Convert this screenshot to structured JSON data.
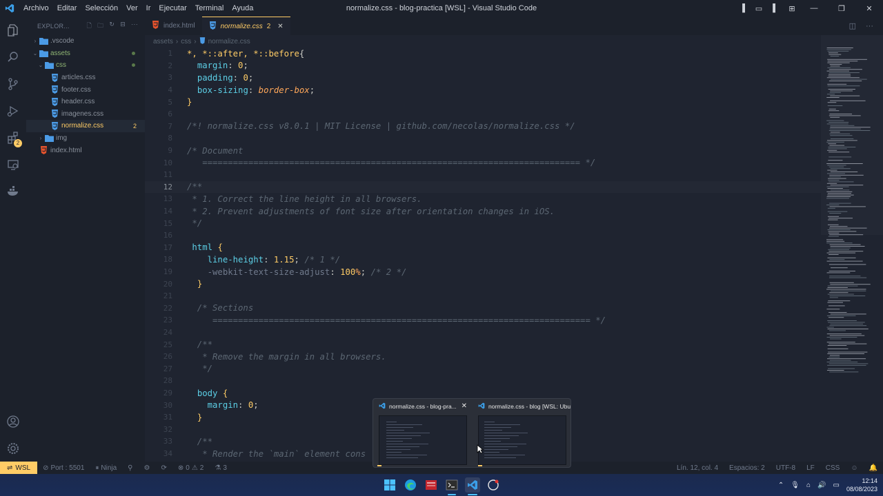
{
  "titlebar": {
    "menu": [
      "Archivo",
      "Editar",
      "Selección",
      "Ver",
      "Ir",
      "Ejecutar",
      "Terminal",
      "Ayuda"
    ],
    "title": "normalize.css - blog-practica [WSL] - Visual Studio Code"
  },
  "sidebar": {
    "header": "EXPLOR...",
    "tree": [
      {
        "label": ".vscode",
        "type": "folder",
        "depth": 0,
        "expanded": false
      },
      {
        "label": "assets",
        "type": "folder",
        "depth": 0,
        "expanded": true,
        "modified": true
      },
      {
        "label": "css",
        "type": "folder",
        "depth": 1,
        "expanded": true,
        "modified": true
      },
      {
        "label": "articles.css",
        "type": "css",
        "depth": 2
      },
      {
        "label": "footer.css",
        "type": "css",
        "depth": 2
      },
      {
        "label": "header.css",
        "type": "css",
        "depth": 2
      },
      {
        "label": "imagenes.css",
        "type": "css",
        "depth": 2
      },
      {
        "label": "normalize.css",
        "type": "css",
        "depth": 2,
        "active": true,
        "badge": "2"
      },
      {
        "label": "img",
        "type": "folder",
        "depth": 1,
        "expanded": false
      },
      {
        "label": "index.html",
        "type": "html",
        "depth": 0
      }
    ]
  },
  "tabs": [
    {
      "label": "index.html",
      "icon": "html-file-icon",
      "active": false
    },
    {
      "label": "normalize.css",
      "icon": "css-file-icon",
      "active": true,
      "problems": "2"
    }
  ],
  "breadcrumb": [
    "assets",
    "css",
    "normalize.css"
  ],
  "editor": {
    "current_line": 12,
    "lines": [
      {
        "n": "1",
        "tokens": [
          [
            "sel",
            "*, *::after, *::before"
          ],
          [
            "punc",
            "{"
          ]
        ]
      },
      {
        "n": "2",
        "tokens": [
          [
            "punc",
            "  "
          ],
          [
            "prop",
            "margin"
          ],
          [
            "punc",
            ": "
          ],
          [
            "num",
            "0"
          ],
          [
            "punc",
            ";"
          ]
        ]
      },
      {
        "n": "3",
        "tokens": [
          [
            "punc",
            "  "
          ],
          [
            "prop",
            "padding"
          ],
          [
            "punc",
            ": "
          ],
          [
            "num",
            "0"
          ],
          [
            "punc",
            ";"
          ]
        ]
      },
      {
        "n": "4",
        "tokens": [
          [
            "punc",
            "  "
          ],
          [
            "prop",
            "box-sizing"
          ],
          [
            "punc",
            ": "
          ],
          [
            "val",
            "border-box"
          ],
          [
            "punc",
            ";"
          ]
        ]
      },
      {
        "n": "5",
        "tokens": [
          [
            "sel",
            "}"
          ]
        ]
      },
      {
        "n": "6",
        "tokens": []
      },
      {
        "n": "7",
        "tokens": [
          [
            "com",
            "/*! normalize.css v8.0.1 | MIT License | github.com/necolas/normalize.css */"
          ]
        ]
      },
      {
        "n": "8",
        "tokens": []
      },
      {
        "n": "9",
        "tokens": [
          [
            "com",
            "/* Document"
          ]
        ]
      },
      {
        "n": "10",
        "tokens": [
          [
            "com",
            "   ========================================================================== */"
          ]
        ]
      },
      {
        "n": "11",
        "tokens": []
      },
      {
        "n": "12",
        "tokens": [
          [
            "com",
            "/**"
          ]
        ]
      },
      {
        "n": "13",
        "tokens": [
          [
            "com",
            " * 1. Correct the line height in all browsers."
          ]
        ]
      },
      {
        "n": "14",
        "tokens": [
          [
            "com",
            " * 2. Prevent adjustments of font size after orientation changes in iOS."
          ]
        ]
      },
      {
        "n": "15",
        "tokens": [
          [
            "com",
            " */"
          ]
        ]
      },
      {
        "n": "16",
        "tokens": []
      },
      {
        "n": "17",
        "tokens": [
          [
            "punc",
            " "
          ],
          [
            "prop",
            "html"
          ],
          [
            "punc",
            " "
          ],
          [
            "sel",
            "{"
          ]
        ]
      },
      {
        "n": "18",
        "tokens": [
          [
            "punc",
            "    "
          ],
          [
            "prop",
            "line-height"
          ],
          [
            "punc",
            ": "
          ],
          [
            "num",
            "1.15"
          ],
          [
            "punc",
            "; "
          ],
          [
            "com",
            "/* 1 */"
          ]
        ]
      },
      {
        "n": "19",
        "tokens": [
          [
            "punc",
            "    "
          ],
          [
            "vend",
            "-webkit-text-size-adjust"
          ],
          [
            "punc",
            ": "
          ],
          [
            "num",
            "100"
          ],
          [
            "unit",
            "%"
          ],
          [
            "punc",
            "; "
          ],
          [
            "com",
            "/* 2 */"
          ]
        ]
      },
      {
        "n": "20",
        "tokens": [
          [
            "punc",
            "  "
          ],
          [
            "sel",
            "}"
          ]
        ]
      },
      {
        "n": "21",
        "tokens": []
      },
      {
        "n": "22",
        "tokens": [
          [
            "com",
            "  /* Sections"
          ]
        ]
      },
      {
        "n": "23",
        "tokens": [
          [
            "com",
            "     ========================================================================== */"
          ]
        ]
      },
      {
        "n": "24",
        "tokens": []
      },
      {
        "n": "25",
        "tokens": [
          [
            "com",
            "  /**"
          ]
        ]
      },
      {
        "n": "26",
        "tokens": [
          [
            "com",
            "   * Remove the margin in all browsers."
          ]
        ]
      },
      {
        "n": "27",
        "tokens": [
          [
            "com",
            "   */"
          ]
        ]
      },
      {
        "n": "28",
        "tokens": []
      },
      {
        "n": "29",
        "tokens": [
          [
            "punc",
            "  "
          ],
          [
            "prop",
            "body"
          ],
          [
            "punc",
            " "
          ],
          [
            "sel",
            "{"
          ]
        ]
      },
      {
        "n": "30",
        "tokens": [
          [
            "punc",
            "    "
          ],
          [
            "prop",
            "margin"
          ],
          [
            "punc",
            ": "
          ],
          [
            "num",
            "0"
          ],
          [
            "punc",
            ";"
          ]
        ]
      },
      {
        "n": "31",
        "tokens": [
          [
            "punc",
            "  "
          ],
          [
            "sel",
            "}"
          ]
        ]
      },
      {
        "n": "32",
        "tokens": []
      },
      {
        "n": "33",
        "tokens": [
          [
            "com",
            "  /**"
          ]
        ]
      },
      {
        "n": "34",
        "tokens": [
          [
            "com",
            "   * Render the `main` element cons"
          ]
        ]
      }
    ]
  },
  "statusbar": {
    "remote": "WSL",
    "port": "Port : 5501",
    "ninja": "Ninja",
    "errors": "0",
    "warnings": "2",
    "extra": "3",
    "position": "Lín. 12, col. 4",
    "spaces": "Espacios: 2",
    "encoding": "UTF-8",
    "eol": "LF",
    "language": "CSS"
  },
  "taskbar_preview": [
    {
      "title": "normalize.css - blog-pra...",
      "has_close": true
    },
    {
      "title": "normalize.css - blog [WSL: Ubu...",
      "has_close": false
    }
  ],
  "tray": {
    "time": "12:14",
    "date": "08/08/2023"
  },
  "colors": {
    "accent": "#ffcc66",
    "bg": "#1f2430",
    "property": "#5ccfe6",
    "comment": "#5c6773",
    "value": "#ffa759"
  }
}
